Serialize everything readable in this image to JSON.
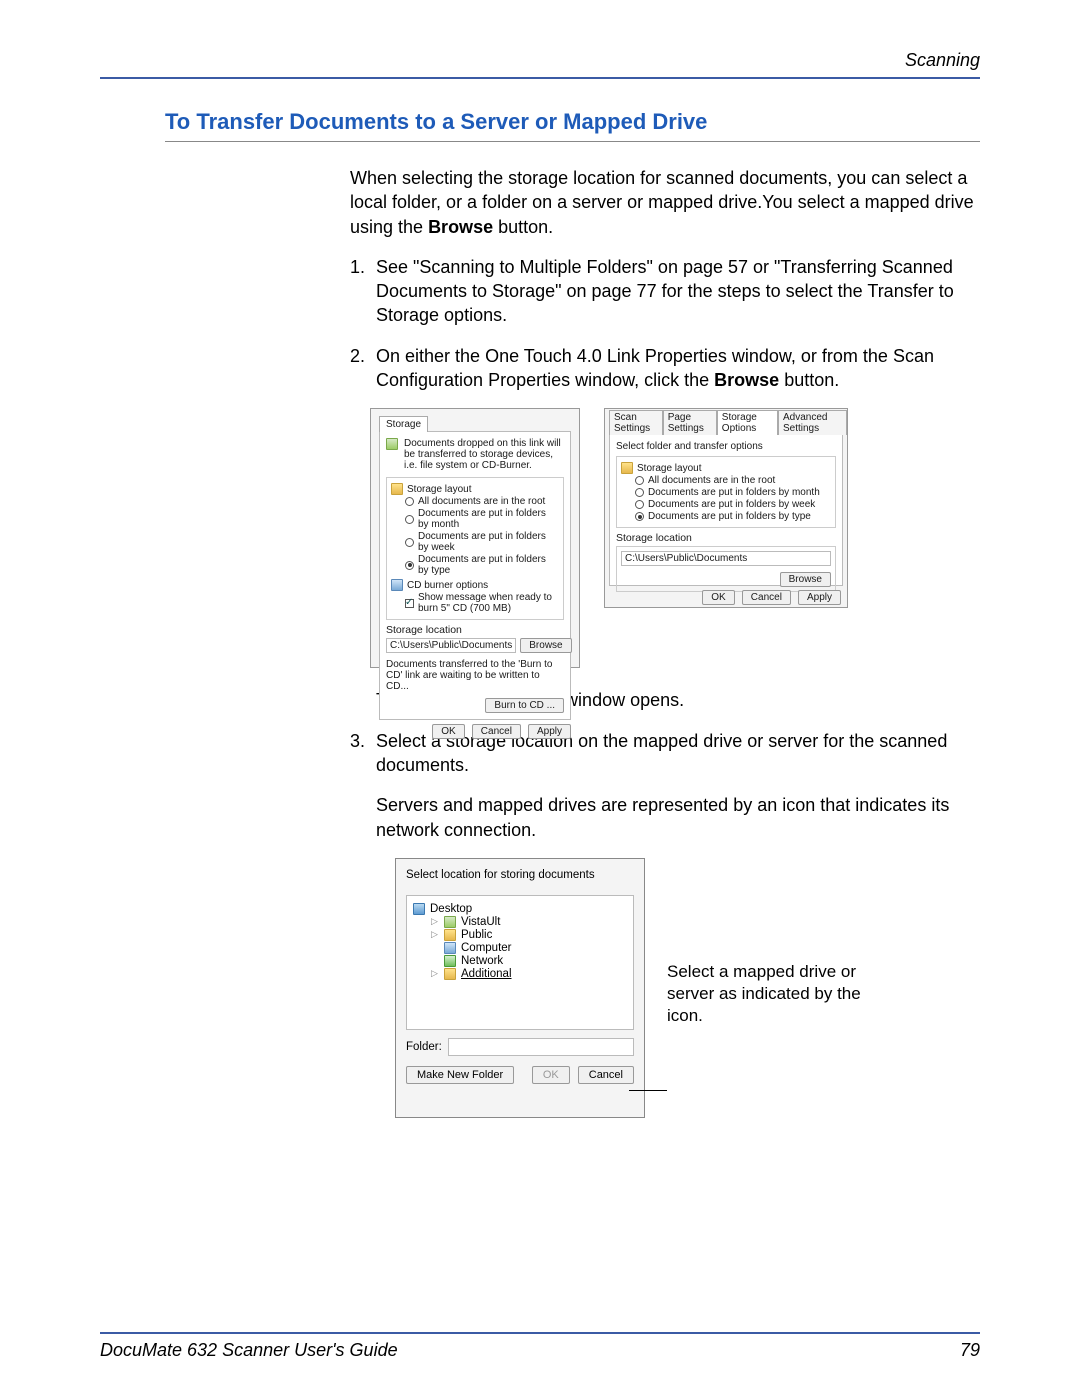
{
  "header": {
    "section": "Scanning"
  },
  "title": "To Transfer Documents to a Server or Mapped Drive",
  "intro": {
    "p1a": "When selecting the storage location for scanned documents, you can select a local folder, or a folder on a server or mapped drive.You select a mapped drive using the ",
    "p1b": "Browse",
    "p1c": " button."
  },
  "steps": {
    "s1": {
      "n": "1.",
      "t": "See \"Scanning to Multiple Folders\" on page 57 or \"Transferring Scanned Documents to Storage\" on page 77 for the steps to select the Transfer to Storage options."
    },
    "s2": {
      "n": "2.",
      "ta": "On either the One Touch 4.0 Link Properties window, or from the Scan Configuration Properties window, click the ",
      "tb": "Browse",
      "tc": " button."
    },
    "s2after": "The Browse For Folder window opens.",
    "s3": {
      "n": "3.",
      "t": "Select a storage location on the mapped drive or server for the scanned documents."
    },
    "s3after": "Servers and mapped drives are represented by an icon that indicates its network connection."
  },
  "dlgL": {
    "tab": "Storage",
    "desc": "Documents dropped on this link will be transferred to storage devices, i.e. file system or CD-Burner.",
    "layout_label": "Storage layout",
    "r1": "All documents are in the root",
    "r2": "Documents are put in folders by month",
    "r3": "Documents are put in folders by week",
    "r4": "Documents are put in folders by type",
    "cd_label": "CD burner options",
    "cd_opt": "Show message when ready to burn 5\" CD (700 MB)",
    "loc_label": "Storage location",
    "loc_val": "C:\\Users\\Public\\Documents",
    "browse": "Browse",
    "burn_msg": "Documents transferred to the 'Burn to CD' link are waiting to be written to CD...",
    "burn_btn": "Burn to CD ...",
    "ok": "OK",
    "cancel": "Cancel",
    "apply": "Apply"
  },
  "dlgR": {
    "t1": "Scan Settings",
    "t2": "Page Settings",
    "t3": "Storage Options",
    "t4": "Advanced Settings",
    "top": "Select folder and transfer options",
    "layout_label": "Storage layout",
    "r1": "All documents are in the root",
    "r2": "Documents are put in folders by month",
    "r3": "Documents are put in folders by week",
    "r4": "Documents are put in folders by type",
    "loc_label": "Storage location",
    "loc_val": "C:\\Users\\Public\\Documents",
    "browse": "Browse",
    "ok": "OK",
    "cancel": "Cancel",
    "apply": "Apply"
  },
  "browse": {
    "heading": "Select location for storing documents",
    "nodes": {
      "desktop": "Desktop",
      "vista": "VistaUlt",
      "public": "Public",
      "computer": "Computer",
      "network": "Network",
      "additional": "Additional"
    },
    "folder_label": "Folder:",
    "mknew": "Make New Folder",
    "ok": "OK",
    "cancel": "Cancel"
  },
  "callout": "Select a mapped drive or server as indicated by the icon.",
  "footer": {
    "guide": "DocuMate 632 Scanner User's Guide",
    "page": "79"
  }
}
